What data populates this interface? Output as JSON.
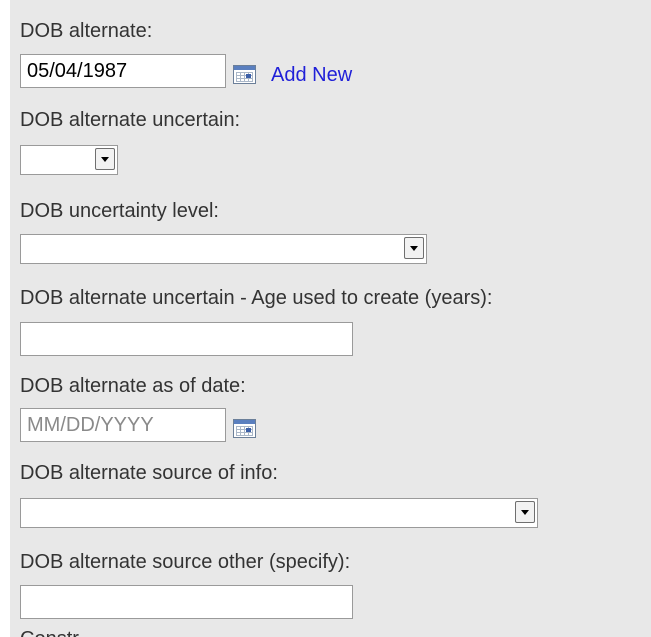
{
  "form": {
    "dob_alternate": {
      "label": "DOB alternate:",
      "value": "05/04/1987",
      "calendar_icon": "calendar-icon",
      "add_new_label": "Add New"
    },
    "dob_alternate_uncertain": {
      "label": "DOB alternate uncertain:",
      "selected": ""
    },
    "dob_uncertainty_level": {
      "label": "DOB uncertainty level:",
      "selected": ""
    },
    "dob_age_used": {
      "label": "DOB alternate uncertain - Age used to create (years):",
      "value": ""
    },
    "dob_as_of_date": {
      "label": "DOB alternate as of date:",
      "value": "",
      "placeholder": "MM/DD/YYYY",
      "calendar_icon": "calendar-icon"
    },
    "dob_source_of_info": {
      "label": "DOB alternate source of info:",
      "selected": ""
    },
    "dob_source_other": {
      "label": "DOB alternate source other (specify):",
      "value": ""
    },
    "next_label_fragment": "Constr"
  },
  "colors": {
    "panel_background": "#e8e8e8",
    "label_text": "#333333",
    "link_text": "#1f1fd8",
    "input_border": "#9a9a9a",
    "placeholder_text": "#8a8a8a"
  }
}
